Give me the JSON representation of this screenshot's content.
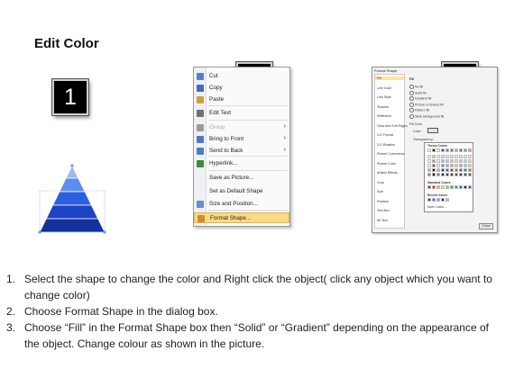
{
  "title": "Edit Color",
  "steps": [
    "1",
    "2",
    "3"
  ],
  "menu": {
    "items": [
      {
        "label": "Cut",
        "icon": "scissors-icon",
        "disabled": false,
        "arrow": false,
        "active": false
      },
      {
        "label": "Copy",
        "icon": "copy-icon",
        "disabled": false,
        "arrow": false,
        "active": false
      },
      {
        "label": "Paste",
        "icon": "paste-icon",
        "disabled": false,
        "arrow": false,
        "active": false
      },
      {
        "label": "Edit Text",
        "icon": "edit-text-icon",
        "disabled": false,
        "arrow": false,
        "active": false
      },
      {
        "label": "Group",
        "icon": "group-icon",
        "disabled": true,
        "arrow": true,
        "active": false
      },
      {
        "label": "Bring to Front",
        "icon": "bring-front-icon",
        "disabled": false,
        "arrow": true,
        "active": false
      },
      {
        "label": "Send to Back",
        "icon": "send-back-icon",
        "disabled": false,
        "arrow": true,
        "active": false
      },
      {
        "label": "Hyperlink...",
        "icon": "hyperlink-icon",
        "disabled": false,
        "arrow": false,
        "active": false
      },
      {
        "label": "Save as Picture...",
        "icon": "",
        "disabled": false,
        "arrow": false,
        "active": false
      },
      {
        "label": "Set as Default Shape",
        "icon": "",
        "disabled": false,
        "arrow": false,
        "active": false
      },
      {
        "label": "Size and Position...",
        "icon": "size-icon",
        "disabled": false,
        "arrow": false,
        "active": false
      },
      {
        "label": "Format Shape...",
        "icon": "format-shape-icon",
        "disabled": false,
        "arrow": false,
        "active": true
      }
    ]
  },
  "dialog": {
    "title": "Format Shape",
    "sidebar": [
      "Fill",
      "Line Color",
      "Line Style",
      "Shadow",
      "Reflection",
      "Glow and Soft Edges",
      "3-D Format",
      "3-D Rotation",
      "Picture Corrections",
      "Picture Color",
      "Artistic Effects",
      "Crop",
      "Size",
      "Position",
      "Text Box",
      "Alt Text"
    ],
    "fill_heading": "Fill",
    "options": [
      "No fill",
      "Solid fill",
      "Gradient fill",
      "Picture or texture fill",
      "Pattern fill",
      "Slide background fill"
    ],
    "fill_color_heading": "Fill Color",
    "color_label": "Color:",
    "transparency_label": "Transparency:",
    "close_label": "Close"
  },
  "picker": {
    "theme_label": "Theme Colors",
    "standard_label": "Standard Colors",
    "recent_label": "Recent Colors",
    "more_label": "More Colors..."
  },
  "colors": {
    "pyramid": [
      "#9ab9f0",
      "#5b8ef0",
      "#2c5fe0",
      "#1e43c4",
      "#16309e"
    ],
    "menu_highlight": "#fcd985",
    "theme_columns": [
      "#ffffff",
      "#000000",
      "#eeece1",
      "#1f497d",
      "#4f81bd",
      "#c0504d",
      "#9bbb59",
      "#8064a2",
      "#4bacc6",
      "#f79646"
    ],
    "standard": [
      "#c00000",
      "#ff0000",
      "#ffc000",
      "#ffff00",
      "#92d050",
      "#00b050",
      "#00b0f0",
      "#0070c0",
      "#002060",
      "#7030a0"
    ],
    "recent": [
      "#1f3a93",
      "#3b62d6",
      "#7fa0e8",
      "#2d2d2d",
      "#bfbfbf"
    ]
  },
  "instructions": [
    {
      "num": "1.",
      "text": "Select the shape to change the color and Right click the object( click any object which you want to change color)"
    },
    {
      "num": "2.",
      "text": "Choose Format Shape in the dialog box."
    },
    {
      "num": "3.",
      "text": "Choose “Fill” in the Format Shape box then “Solid” or “Gradient” depending on the appearance of the object. Change colour as shown in the picture."
    }
  ]
}
